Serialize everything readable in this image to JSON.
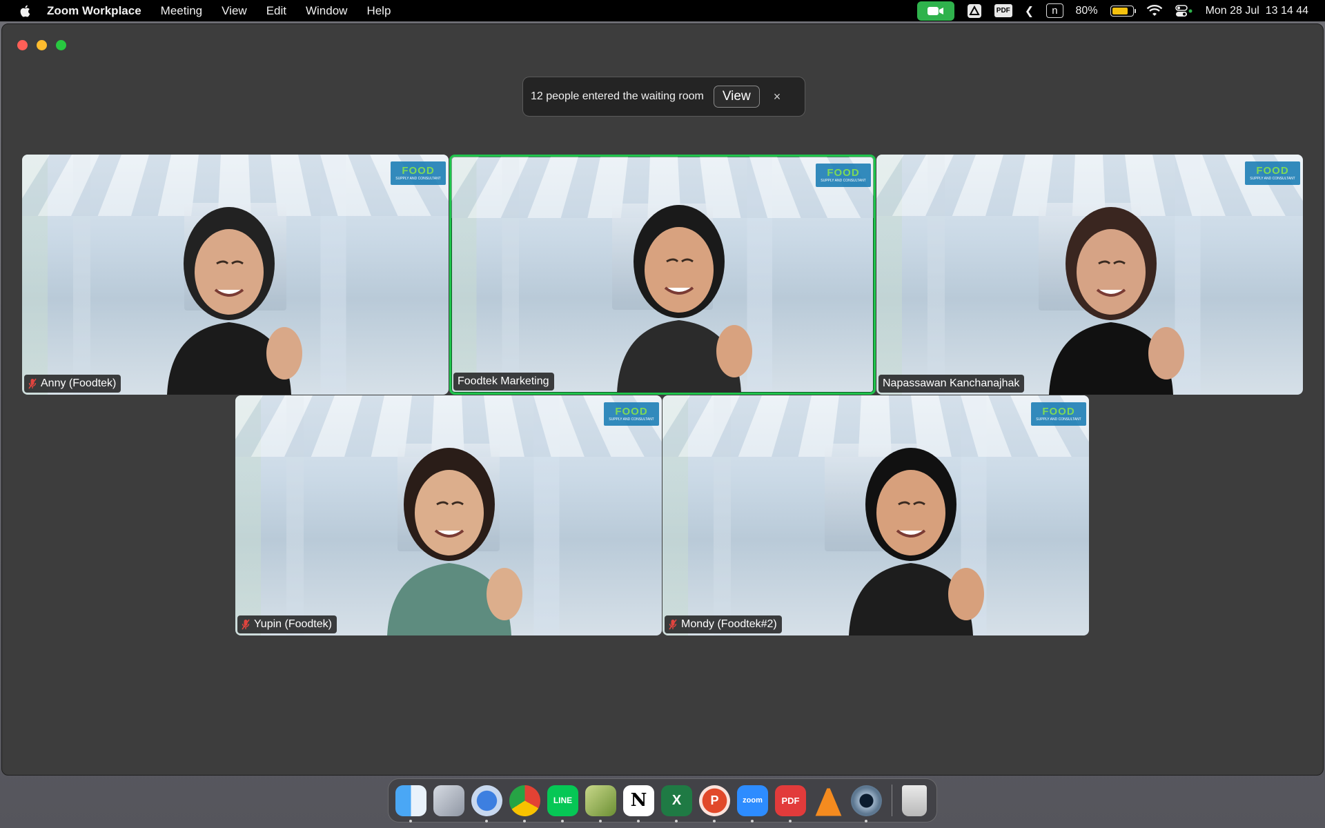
{
  "menubar": {
    "app_name": "Zoom Workplace",
    "menus": [
      "Meeting",
      "View",
      "Edit",
      "Window",
      "Help"
    ],
    "pdf_label": "PDF",
    "chevron": "❮",
    "n_label": "n",
    "battery_percent": "80%",
    "battery_level": 0.8,
    "clock": "Mon 28 Jul  13 14 44"
  },
  "toast": {
    "message": "12 people entered the waiting room",
    "view_label": "View",
    "close_glyph": "×"
  },
  "participants": [
    {
      "name": "Anny (Foodtek)",
      "muted": true,
      "active": false
    },
    {
      "name": "Foodtek Marketing",
      "muted": false,
      "active": true
    },
    {
      "name": "Napassawan Kanchanajhak",
      "muted": false,
      "active": false
    },
    {
      "name": "Yupin (Foodtek)",
      "muted": true,
      "active": false
    },
    {
      "name": "Mondy (Foodtek#2)",
      "muted": true,
      "active": false
    }
  ],
  "background_logo": {
    "word": "FOOD",
    "tag": "SUPPLY AND CONSULTANT"
  },
  "colors": {
    "active_speaker": "#1fc44c",
    "menubar_video": "#2fb24c",
    "muted_mic": "#e0443e"
  },
  "dock": {
    "apps": [
      {
        "name": "Finder",
        "label": ""
      },
      {
        "name": "Launchpad",
        "label": ""
      },
      {
        "name": "Thunderbird",
        "label": ""
      },
      {
        "name": "Chrome",
        "label": ""
      },
      {
        "name": "LINE",
        "label": "LINE"
      },
      {
        "name": "Scrivener",
        "label": ""
      },
      {
        "name": "Notion",
        "label": "N"
      },
      {
        "name": "Excel",
        "label": "X"
      },
      {
        "name": "PowerPoint",
        "label": "P"
      },
      {
        "name": "Zoom",
        "label": "zoom"
      },
      {
        "name": "PDF Expert",
        "label": "PDF"
      },
      {
        "name": "VLC",
        "label": ""
      },
      {
        "name": "QuickTime",
        "label": ""
      },
      {
        "name": "Trash",
        "label": ""
      }
    ]
  }
}
